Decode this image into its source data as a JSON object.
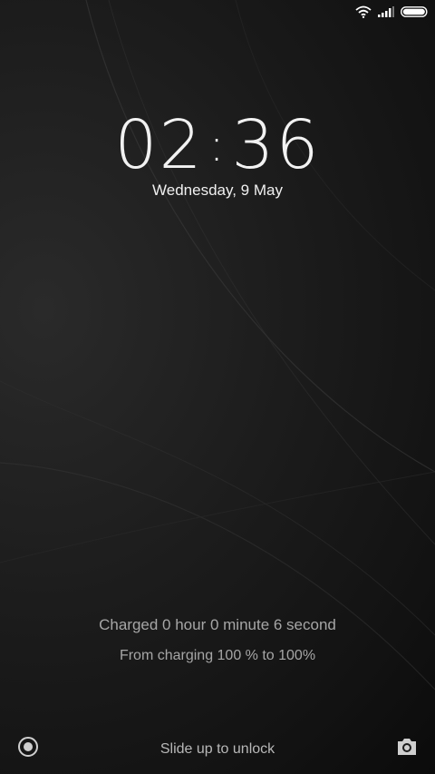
{
  "status_bar": {
    "wifi_icon": "wifi-icon",
    "signal_icon": "cell-signal-icon",
    "battery_icon": "battery-icon",
    "battery_level": 1.0
  },
  "clock": {
    "hours": "02",
    "separator": ":",
    "minutes": "36"
  },
  "date": "Wednesday, 9 May",
  "charging": {
    "line1": "Charged 0 hour 0 minute 6 second",
    "line2": "From charging 100 % to 100%"
  },
  "bottom": {
    "unlock_hint": "Slide up to unlock",
    "left_icon": "record-icon",
    "right_icon": "camera-icon"
  },
  "colors": {
    "background": "#1b1b1b",
    "text_primary": "#f2f2f2",
    "text_secondary": "#a6a6a6"
  }
}
